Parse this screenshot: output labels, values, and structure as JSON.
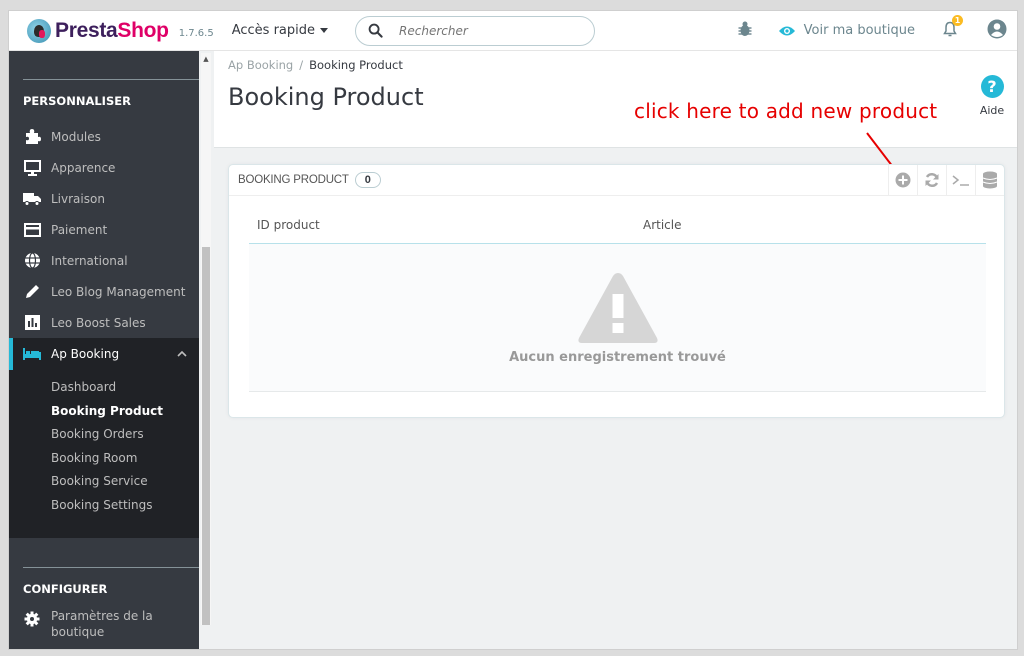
{
  "header": {
    "brand_first": "Presta",
    "brand_second": "Shop",
    "version": "1.7.6.5",
    "quick_access": "Accès rapide",
    "search_placeholder": "Rechercher",
    "view_shop": "Voir ma boutique",
    "notification_count": "1"
  },
  "sidebar": {
    "section_personalize": "PERSONNALISER",
    "items": [
      {
        "label": "Modules",
        "icon": "puzzle-icon"
      },
      {
        "label": "Apparence",
        "icon": "monitor-icon"
      },
      {
        "label": "Livraison",
        "icon": "truck-icon"
      },
      {
        "label": "Paiement",
        "icon": "credit-card-icon"
      },
      {
        "label": "International",
        "icon": "globe-icon"
      },
      {
        "label": "Leo Blog Management",
        "icon": "pencil-icon"
      },
      {
        "label": "Leo Boost Sales",
        "icon": "bar-chart-icon"
      }
    ],
    "active_item": {
      "label": "Ap Booking",
      "icon": "bed-icon"
    },
    "sub_items": [
      {
        "label": "Dashboard"
      },
      {
        "label": "Booking Product"
      },
      {
        "label": "Booking Orders"
      },
      {
        "label": "Booking Room"
      },
      {
        "label": "Booking Service"
      },
      {
        "label": "Booking Settings"
      }
    ],
    "section_configure": "CONFIGURER",
    "config_item": {
      "label_line1": "Paramètres de la",
      "label_line2": "boutique",
      "icon": "gear-icon"
    }
  },
  "page": {
    "breadcrumb_parent": "Ap Booking",
    "breadcrumb_sep": "/",
    "breadcrumb_current": "Booking Product",
    "title": "Booking Product",
    "help_label": "Aide"
  },
  "annotation": "click here to add new product",
  "panel": {
    "title": "BOOKING PRODUCT",
    "count": "0",
    "columns": [
      "ID product",
      "Article"
    ],
    "empty_message": "Aucun enregistrement trouvé"
  },
  "colors": {
    "accent": "#25b9d7",
    "sidebar_bg": "#363a41",
    "annotation": "#e60000",
    "brand_purple": "#3d1f5c",
    "brand_pink": "#df0067"
  }
}
